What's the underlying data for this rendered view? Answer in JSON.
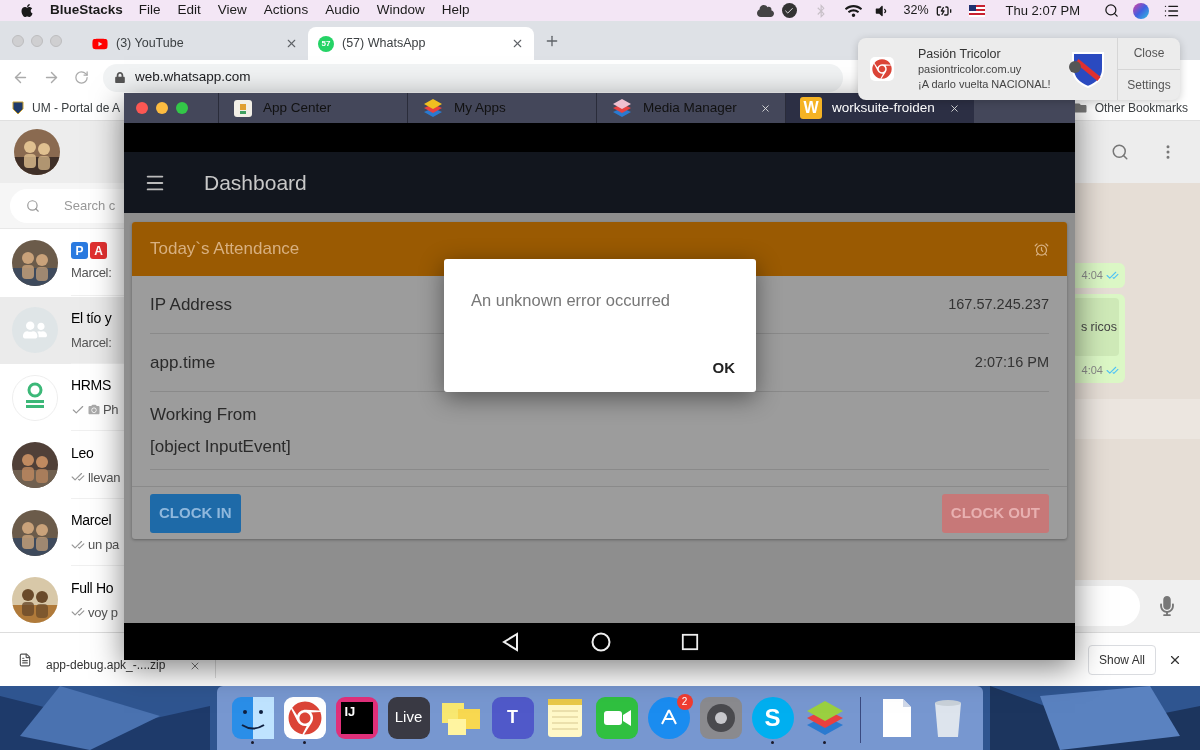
{
  "menu_bar": {
    "app_name": "BlueStacks",
    "menus": [
      "File",
      "Edit",
      "View",
      "Actions",
      "Audio",
      "Window",
      "Help"
    ],
    "battery": "32%",
    "clock": "Thu 2:07 PM"
  },
  "browser": {
    "tabs": [
      {
        "title": "(3) YouTube",
        "kind": "youtube",
        "selected": false
      },
      {
        "title": "(57) WhatsApp",
        "kind": "whatsapp",
        "badge": "57",
        "selected": true
      }
    ],
    "url": "web.whatsapp.com",
    "bookmarks": [
      {
        "title": "UM - Portal de A",
        "kind": "shield"
      },
      {
        "title": "Other Bookmarks",
        "kind": "folder"
      }
    ]
  },
  "whatsapp": {
    "search_placeholder": "Search c",
    "chats": [
      {
        "name_badges": [
          "P",
          "A"
        ],
        "preview": "Marcel:",
        "selected": false,
        "sent": false
      },
      {
        "name": "El tío y",
        "preview": "Marcel:",
        "kind": "group",
        "selected": true,
        "sent": false
      },
      {
        "name": "HRMS",
        "preview": "Ph",
        "kind": "logo",
        "selected": false,
        "sent": true,
        "delivered": false
      },
      {
        "name": "Leo",
        "preview": "llevan",
        "selected": false,
        "sent": true,
        "delivered": true
      },
      {
        "name": "Marcel",
        "preview": "un pa",
        "selected": false,
        "sent": true,
        "delivered": true
      },
      {
        "name": "Full Ho",
        "preview": "voy p",
        "selected": false,
        "sent": true,
        "delivered": true
      }
    ],
    "messages": [
      {
        "time": "4:04",
        "read": true
      },
      {
        "text": "s ricos",
        "time": "4:04",
        "read": true
      }
    ]
  },
  "download": {
    "file": "app-debug.apk_-....zip",
    "show_all": "Show All"
  },
  "notification": {
    "title": "Pasión Tricolor",
    "source": "pasiontricolor.com.uy",
    "body": "¡A darlo vuelta NACIONAL!",
    "actions": [
      "Close",
      "Settings"
    ]
  },
  "bluestacks": {
    "tabs": [
      {
        "title": "App Center",
        "kind": "appcenter",
        "closable": false,
        "selected": false
      },
      {
        "title": "My Apps",
        "kind": "myapps",
        "closable": false,
        "selected": false
      },
      {
        "title": "Media Manager",
        "kind": "media",
        "closable": true,
        "selected": false
      },
      {
        "title": "worksuite-froiden",
        "kind": "worksuite",
        "icon_letter": "W",
        "closable": true,
        "selected": true
      }
    ],
    "app": {
      "title": "Dashboard",
      "card_title": "Today`s Attendance",
      "rows": [
        {
          "label": "IP Address",
          "value": "167.57.245.237"
        },
        {
          "label": "app.time",
          "value": "2:07:16 PM"
        },
        {
          "label": "Working From",
          "detail": "[object InputEvent]"
        }
      ],
      "clock_in": "CLOCK IN",
      "clock_out": "CLOCK OUT",
      "dialog": {
        "message": "An unknown error occurred",
        "button": "OK"
      }
    }
  },
  "dock": [
    {
      "kind": "finder",
      "running": true
    },
    {
      "kind": "chrome",
      "running": true
    },
    {
      "kind": "ide",
      "label": "IJ",
      "running": false
    },
    {
      "kind": "live",
      "label": "Live",
      "running": false
    },
    {
      "kind": "stickies",
      "running": false
    },
    {
      "kind": "teams",
      "label": "T",
      "running": false
    },
    {
      "kind": "notes",
      "running": false
    },
    {
      "kind": "facetime",
      "running": false
    },
    {
      "kind": "appstore",
      "badge": "2",
      "running": false
    },
    {
      "kind": "settings",
      "running": false
    },
    {
      "kind": "skype",
      "label": "S",
      "running": true
    },
    {
      "kind": "bluestacks",
      "running": true
    },
    {
      "kind": "divider"
    },
    {
      "kind": "document",
      "running": false
    },
    {
      "kind": "trash",
      "running": false
    }
  ]
}
